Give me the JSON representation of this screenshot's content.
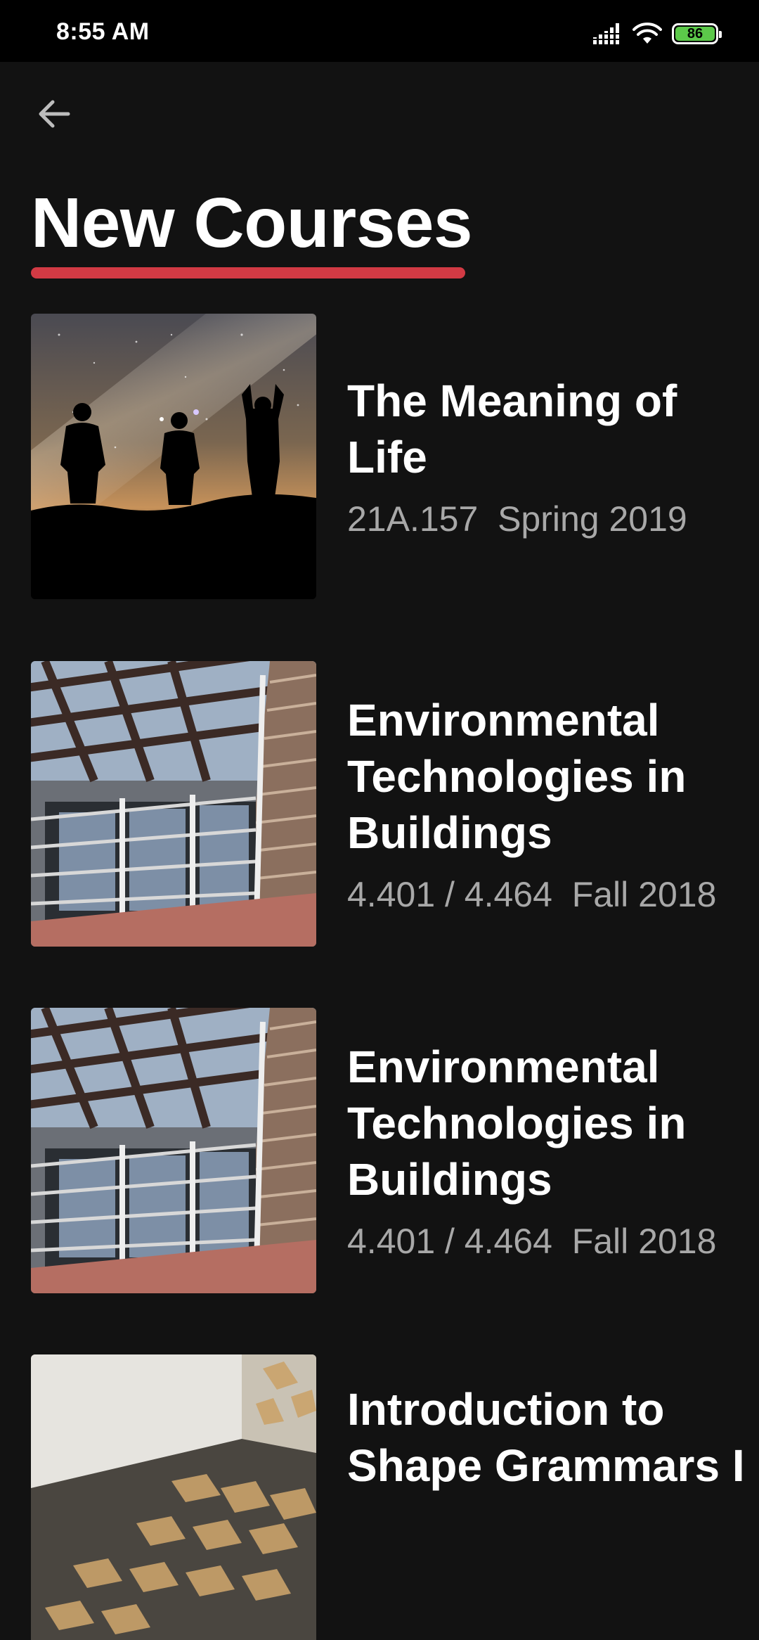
{
  "status_bar": {
    "time": "8:55 AM",
    "battery_level": "86",
    "battery_color": "#5cc94a"
  },
  "header": {
    "back_icon": "arrow-back-icon",
    "title": "New Courses",
    "underline_color": "#d23a44"
  },
  "courses": [
    {
      "title": "The Meaning of Life",
      "meta": "21A.157  Spring 2019",
      "thumbnail": "night-sky-silhouettes-image"
    },
    {
      "title": "Environmental Technologies in Buildings",
      "meta": "4.401 / 4.464  Fall 2018",
      "thumbnail": "building-louvers-image"
    },
    {
      "title": "Environmental Technologies in Buildings",
      "meta": "4.401 / 4.464  Fall 2018",
      "thumbnail": "building-louvers-image"
    },
    {
      "title": "Introduction to Shape Grammars I",
      "meta": "",
      "thumbnail": "shadow-pattern-room-image"
    }
  ]
}
